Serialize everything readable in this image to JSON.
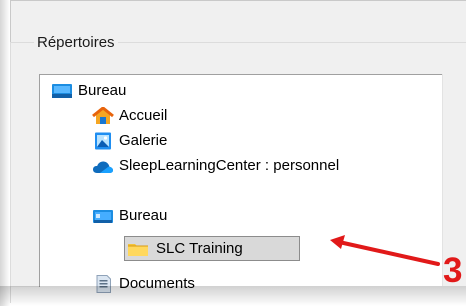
{
  "groupbox": {
    "label": "Répertoires"
  },
  "tree": {
    "items": [
      {
        "label": "Bureau",
        "icon": "desktop-icon"
      },
      {
        "label": "Accueil",
        "icon": "home-icon"
      },
      {
        "label": "Galerie",
        "icon": "gallery-icon"
      },
      {
        "label": "SleepLearningCenter : personnel",
        "icon": "onedrive-cloud-icon"
      },
      {
        "label": "Bureau",
        "icon": "desktop-folder-icon"
      },
      {
        "label": "SLC Training",
        "icon": "folder-icon",
        "selected": true
      },
      {
        "label": "Documents",
        "icon": "documents-icon"
      }
    ]
  },
  "annotation": {
    "number": "3",
    "color": "#e11919"
  },
  "colors": {
    "desktop_blue": "#1c8de1",
    "folder_yellow": "#f3c33a",
    "selection_gray": "#d9d9d9",
    "onedrive_blue": "#0f6cbd"
  }
}
